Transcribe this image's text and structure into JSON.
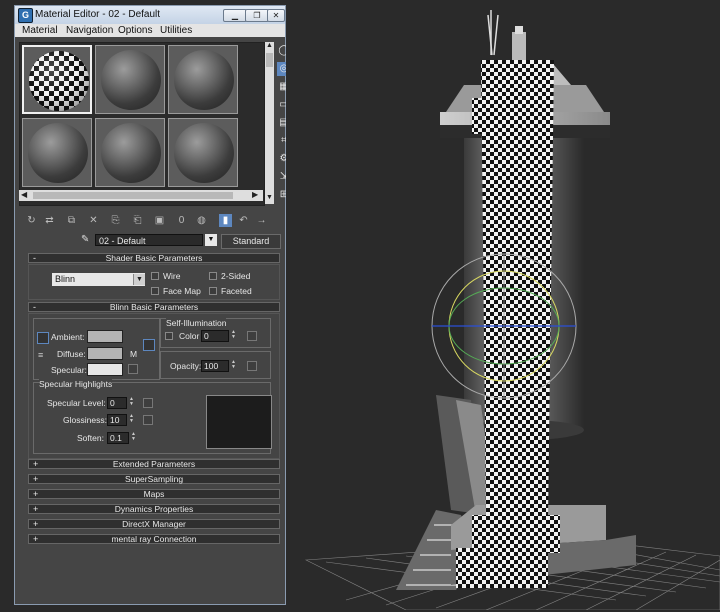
{
  "window": {
    "title": "Material Editor - 02 - Default",
    "icon_letter": "G",
    "controls": [
      "minimize-icon",
      "restore-icon",
      "close-icon"
    ]
  },
  "menu": [
    "Material",
    "Navigation",
    "Options",
    "Utilities"
  ],
  "material": {
    "name": "02 - Default",
    "type": "Standard"
  },
  "shader_basic": {
    "title": "Shader Basic Parameters",
    "shader": "Blinn",
    "options": [
      {
        "label": "Wire",
        "checked": false
      },
      {
        "label": "2-Sided",
        "checked": false
      },
      {
        "label": "Face Map",
        "checked": false
      },
      {
        "label": "Faceted",
        "checked": false
      }
    ]
  },
  "blinn_basic": {
    "title": "Blinn Basic Parameters",
    "ambient_label": "Ambient:",
    "diffuse_label": "Diffuse:",
    "specular_label": "Specular:",
    "map_button": "M",
    "self_illum": {
      "title": "Self-Illumination",
      "color_label": "Color",
      "value": "0"
    },
    "opacity_label": "Opacity:",
    "opacity_value": "100",
    "colors": {
      "ambient": "#b4b4b4",
      "diffuse": "#b4b4b4",
      "specular": "#e6e6e6"
    }
  },
  "specular_highlights": {
    "title": "Specular Highlights",
    "fields": [
      {
        "label": "Specular Level:",
        "value": "0"
      },
      {
        "label": "Glossiness:",
        "value": "10"
      },
      {
        "label": "Soften:",
        "value": "0.1"
      }
    ]
  },
  "collapsed_rollouts": [
    "Extended Parameters",
    "SuperSampling",
    "Maps",
    "Dynamics Properties",
    "DirectX Manager",
    "mental ray Connection"
  ],
  "rollout_signs": {
    "expanded": "-",
    "collapsed": "+"
  },
  "colors": {
    "accent": "#5d87bf",
    "title_bg": "#c4d3e6",
    "panel_bg": "#454545",
    "viewport_bg": "#2a2a2a"
  }
}
